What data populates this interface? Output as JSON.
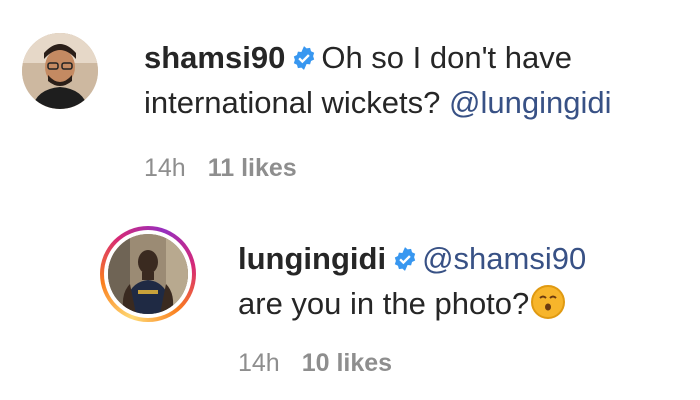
{
  "comments": [
    {
      "username": "shamsi90",
      "text": "Oh so I don't have",
      "text_line2": "international wickets?",
      "mention": "@lungingidi",
      "time": "14h",
      "likes": "11 likes"
    },
    {
      "username": "lungingidi",
      "mention": "@shamsi90",
      "text_line2": "are you in the photo?",
      "emoji": "kissing-face-emoji",
      "time": "14h",
      "likes": "10 likes"
    }
  ],
  "colors": {
    "verified": "#3897f0",
    "mention": "#385185",
    "meta": "#8e8e8e"
  }
}
